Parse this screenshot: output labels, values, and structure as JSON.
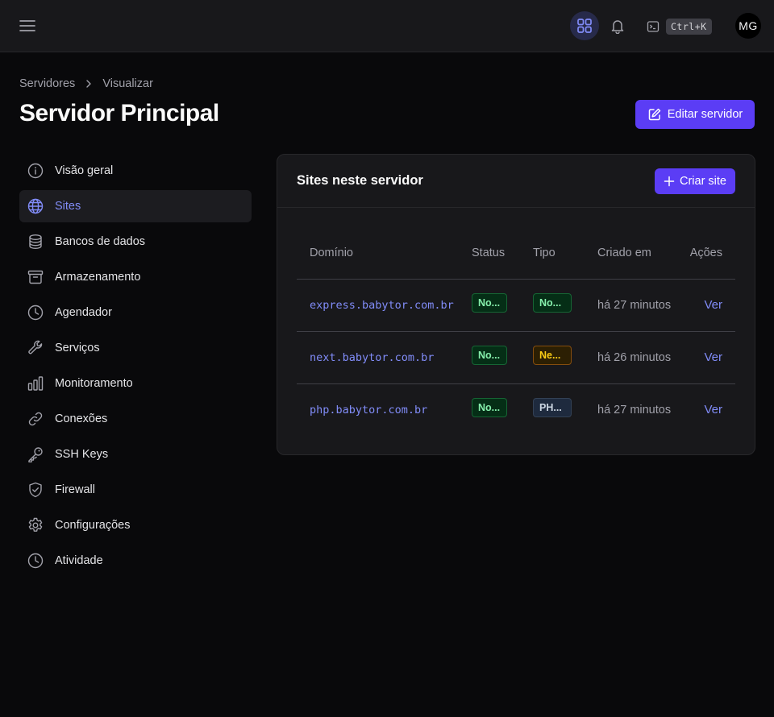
{
  "header": {
    "shortcut": "Ctrl+K",
    "avatar_initials": "MG",
    "accent_bg": "#272a4a"
  },
  "breadcrumb": {
    "items": [
      "Servidores",
      "Visualizar"
    ]
  },
  "page": {
    "title": "Servidor Principal",
    "edit_label": "Editar servidor"
  },
  "sidebar": {
    "items": [
      {
        "label": "Visão geral",
        "icon": "info-icon",
        "active": false
      },
      {
        "label": "Sites",
        "icon": "globe-icon",
        "active": true
      },
      {
        "label": "Bancos de dados",
        "icon": "database-icon",
        "active": false
      },
      {
        "label": "Armazenamento",
        "icon": "archive-icon",
        "active": false
      },
      {
        "label": "Agendador",
        "icon": "clock-icon",
        "active": false
      },
      {
        "label": "Serviços",
        "icon": "wrench-icon",
        "active": false
      },
      {
        "label": "Monitoramento",
        "icon": "bar-chart-icon",
        "active": false
      },
      {
        "label": "Conexões",
        "icon": "link-icon",
        "active": false
      },
      {
        "label": "SSH Keys",
        "icon": "key-icon",
        "active": false
      },
      {
        "label": "Firewall",
        "icon": "shield-check-icon",
        "active": false
      },
      {
        "label": "Configurações",
        "icon": "gear-icon",
        "active": false
      },
      {
        "label": "Atividade",
        "icon": "clock-icon",
        "active": false
      }
    ]
  },
  "sites": {
    "title": "Sites neste servidor",
    "create_label": "Criar site",
    "columns": {
      "domain": "Domínio",
      "status": "Status",
      "type": "Tipo",
      "created": "Criado em",
      "actions": "Ações"
    },
    "rows": [
      {
        "domain": "express.babytor.com.br",
        "status": "No...",
        "type": "No...",
        "created": "há 27 minutos",
        "action": "Ver"
      },
      {
        "domain": "next.babytor.com.br",
        "status": "No...",
        "type": "Ne...",
        "created": "há 26 minutos",
        "action": "Ver"
      },
      {
        "domain": "php.babytor.com.br",
        "status": "No...",
        "type": "PH...",
        "created": "há 27 minutos",
        "action": "Ver"
      }
    ]
  },
  "colors": {
    "background": "#09090b",
    "surface": "#18181b",
    "primary": "#5b3df5",
    "link": "#818cf8",
    "badge_green": "#86efac",
    "badge_yellow": "#facc15",
    "badge_slate": "#cbd5e1"
  }
}
